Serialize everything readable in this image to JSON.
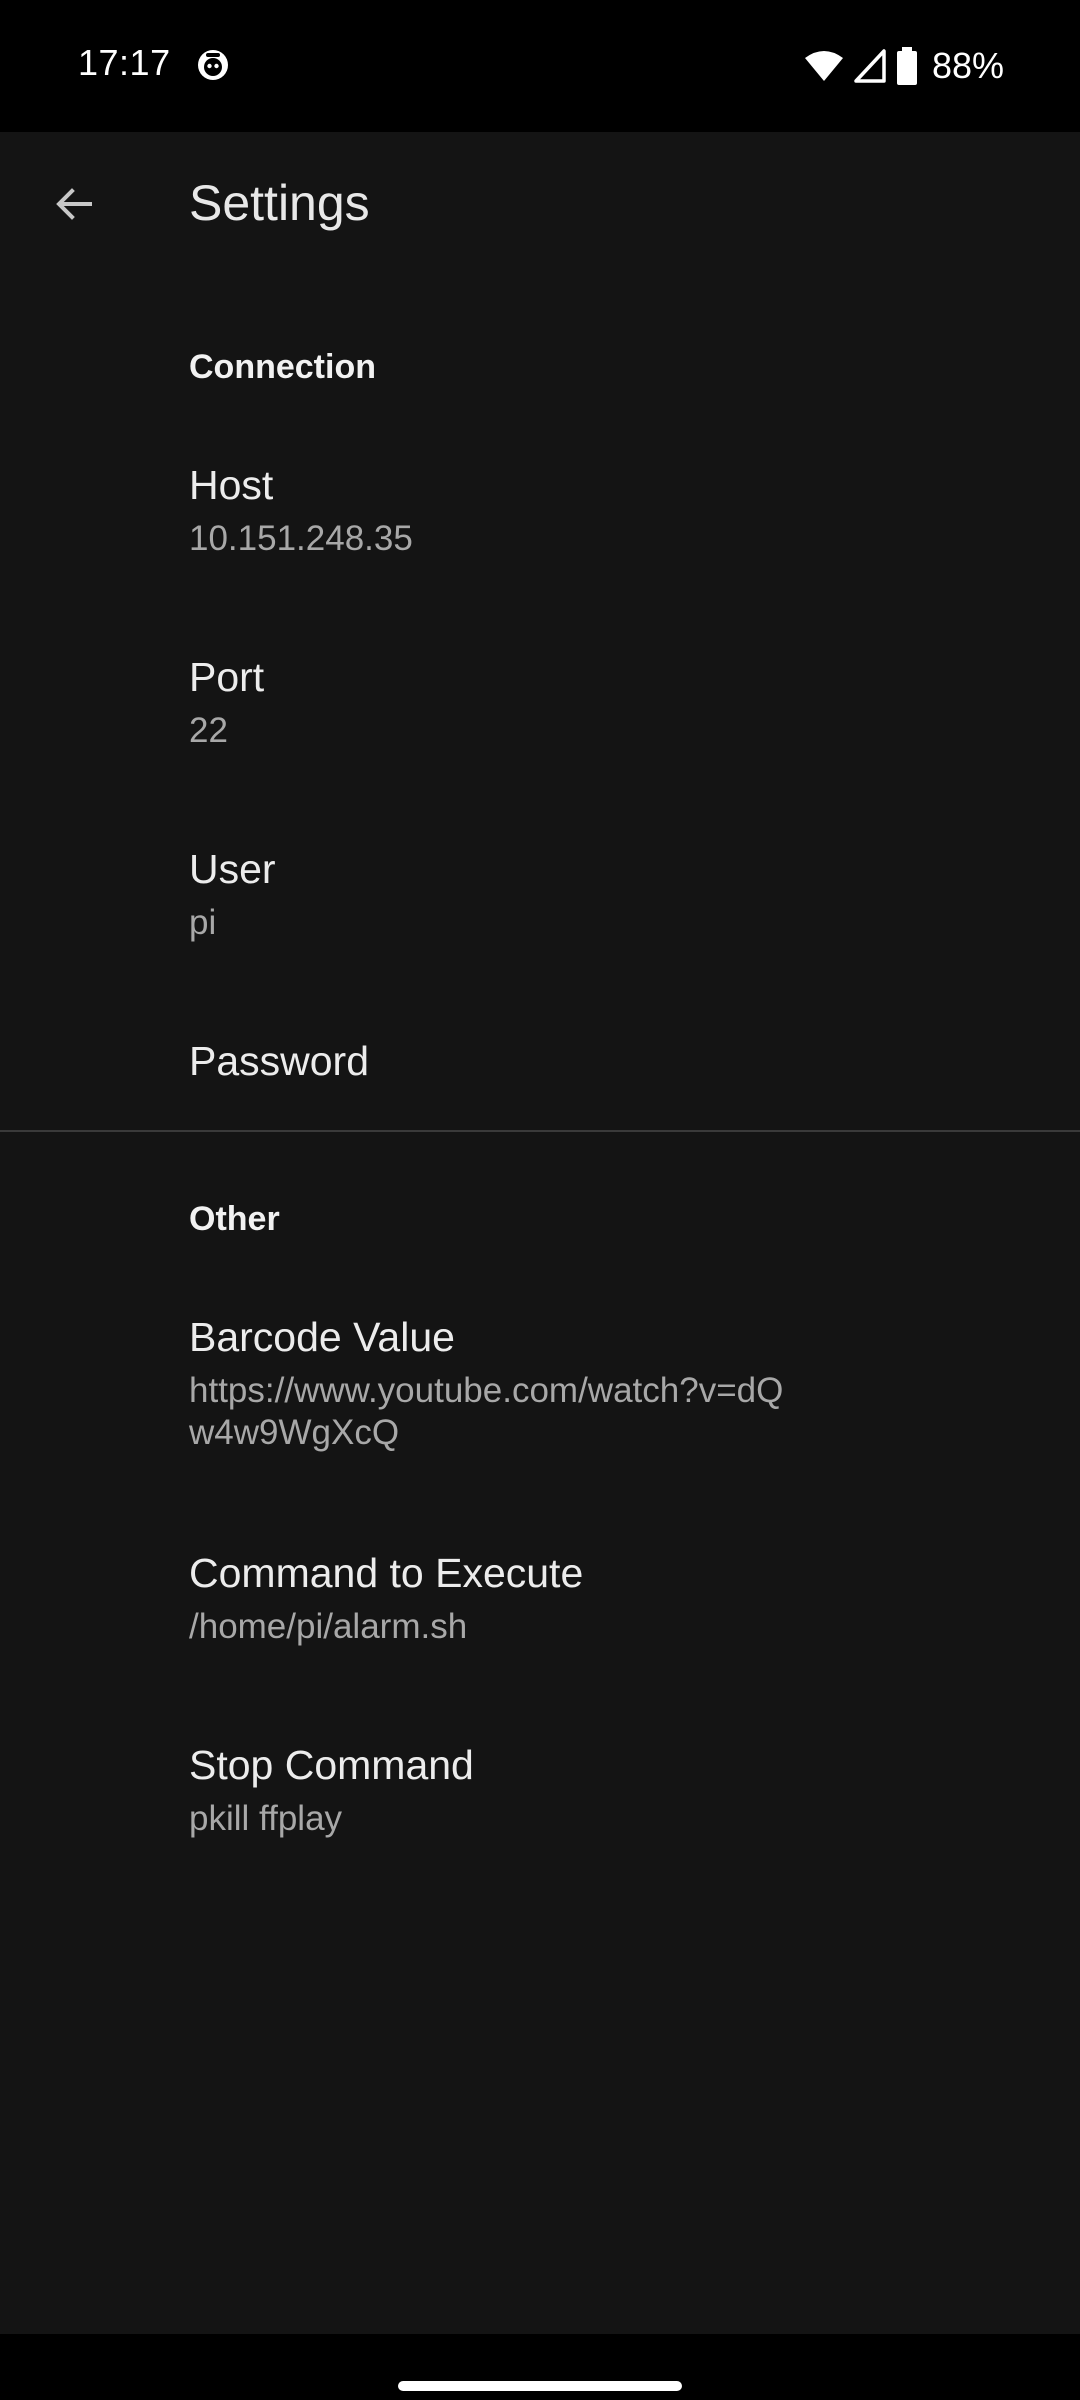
{
  "status_bar": {
    "time": "17:17",
    "battery": "88%"
  },
  "app_bar": {
    "title": "Settings"
  },
  "sections": {
    "connection": {
      "header": "Connection",
      "host": {
        "title": "Host",
        "summary": "10.151.248.35"
      },
      "port": {
        "title": "Port",
        "summary": "22"
      },
      "user": {
        "title": "User",
        "summary": "pi"
      },
      "password": {
        "title": "Password"
      }
    },
    "other": {
      "header": "Other",
      "barcode": {
        "title": "Barcode Value",
        "summary": "https://www.youtube.com/watch?v=dQw4w9WgXcQ"
      },
      "command": {
        "title": "Command to Execute",
        "summary": "/home/pi/alarm.sh"
      },
      "stop": {
        "title": "Stop Command",
        "summary": "pkill ffplay"
      }
    }
  },
  "icons": {
    "back": "arrow-back-icon",
    "app": "app-notification-icon",
    "wifi": "wifi-icon",
    "cellular": "cellular-signal-icon",
    "battery": "battery-icon"
  },
  "colors": {
    "background": "#141414",
    "status_bar": "#000000",
    "title_text": "#ececec",
    "summary_text": "#a8a8a8"
  }
}
